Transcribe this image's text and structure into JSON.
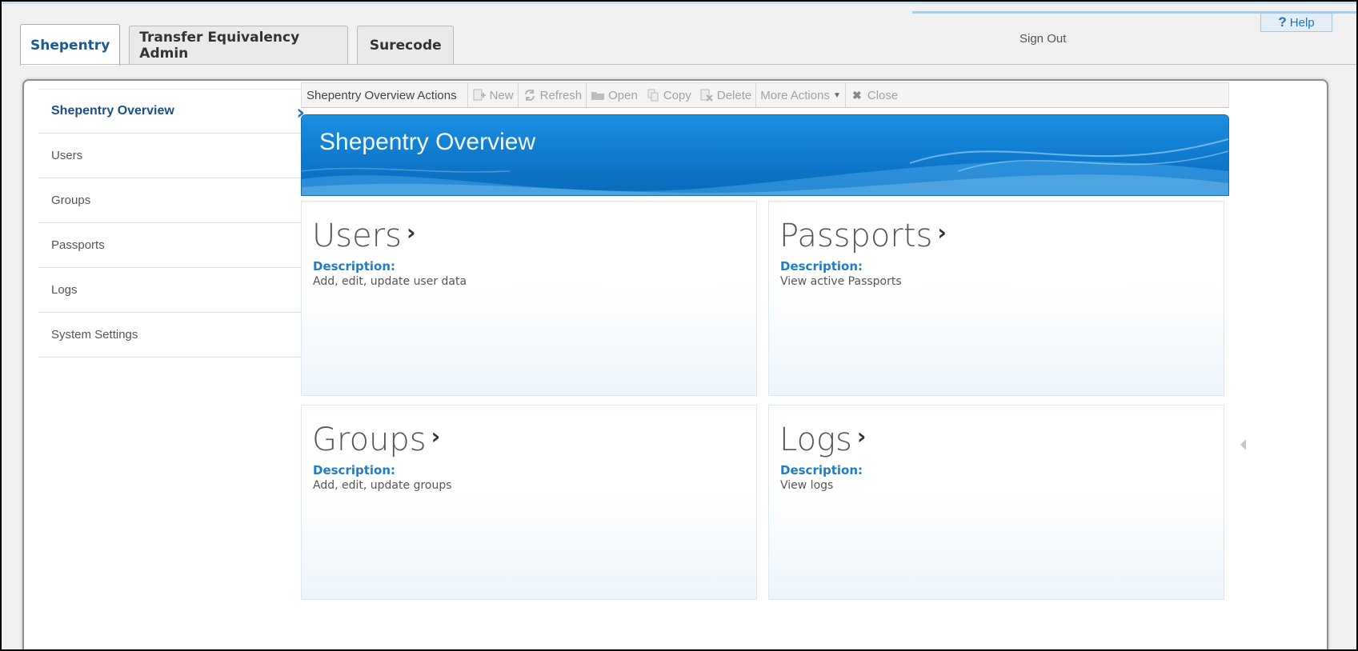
{
  "header": {
    "help_label": "Help",
    "sign_out_label": "Sign Out",
    "tabs": [
      {
        "label": "Shepentry"
      },
      {
        "label": "Transfer Equivalency Admin"
      },
      {
        "label": "Surecode"
      }
    ]
  },
  "sidebar": {
    "items": [
      {
        "label": "Shepentry Overview"
      },
      {
        "label": "Users"
      },
      {
        "label": "Groups"
      },
      {
        "label": "Passports"
      },
      {
        "label": "Logs"
      },
      {
        "label": "System Settings"
      }
    ]
  },
  "toolbar": {
    "title": "Shepentry Overview Actions",
    "new_label": "New",
    "refresh_label": "Refresh",
    "open_label": "Open",
    "copy_label": "Copy",
    "delete_label": "Delete",
    "more_actions_label": "More Actions",
    "close_label": "Close"
  },
  "banner": {
    "title": "Shepentry Overview"
  },
  "cards": [
    {
      "title": "Users",
      "desc_label": "Description:",
      "desc": "Add, edit, update user data"
    },
    {
      "title": "Passports",
      "desc_label": "Description:",
      "desc": "View active Passports"
    },
    {
      "title": "Groups",
      "desc_label": "Description:",
      "desc": "Add, edit, update groups"
    },
    {
      "title": "Logs",
      "desc_label": "Description:",
      "desc": "View logs"
    }
  ],
  "colors": {
    "accent": "#1f7cc5",
    "banner": "#0f79cc",
    "active_tab_text": "#1a5b92"
  }
}
